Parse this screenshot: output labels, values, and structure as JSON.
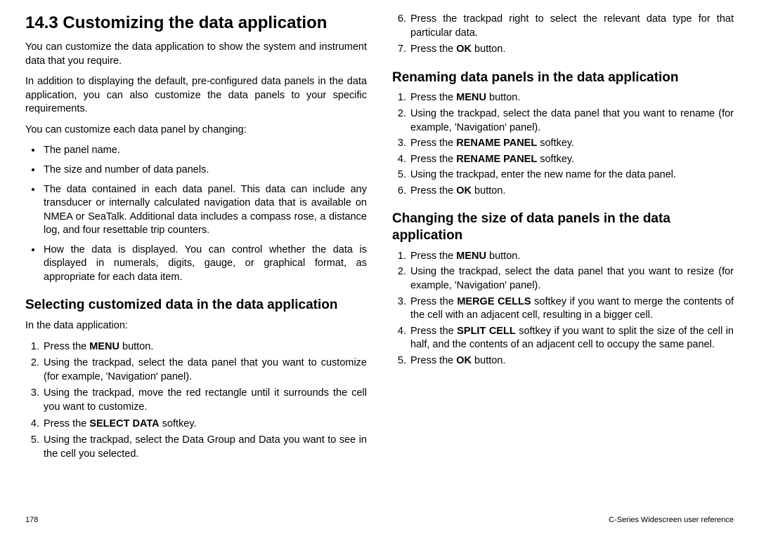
{
  "heading": "14.3 Customizing the data application",
  "para1": "You can customize the data application to show the system and instrument data that you require.",
  "para2": "In addition to displaying the default, pre-configured data panels in the data application, you can also customize the data panels to your specific requirements.",
  "para3": "You can customize each data panel by changing:",
  "bullets": {
    "b1": "The panel name.",
    "b2": "The size and number of data panels.",
    "b3": "The data contained in each data panel. This data can include any transducer or internally calculated navigation data that is available on NMEA or SeaTalk. Additional data includes a compass rose, a distance log, and four resettable trip counters.",
    "b4": "How the data is displayed. You can control whether the data is displayed in numerals, digits, gauge, or graphical format, as appropriate for each data item."
  },
  "sec1": {
    "title": "Selecting customized data in the data application",
    "intro": "In the data application:",
    "s1a": "Press the ",
    "s1b": "MENU",
    "s1c": " button.",
    "s2": "Using the trackpad, select the data panel that you want to customize (for example, 'Navigation' panel).",
    "s3": "Using the trackpad, move the red rectangle until it surrounds the cell you want to customize.",
    "s4a": "Press the ",
    "s4b": "SELECT DATA",
    "s4c": " softkey.",
    "s5": "Using the trackpad, select the Data Group and Data you want to see in the cell you selected.",
    "s6": "Press the trackpad right to select the relevant data type for that particular data.",
    "s7a": "Press the ",
    "s7b": "OK",
    "s7c": " button."
  },
  "sec2": {
    "title": "Renaming data panels in the data application",
    "s1a": "Press the ",
    "s1b": "MENU",
    "s1c": " button.",
    "s2": "Using the trackpad, select the data panel that you want to rename (for example, 'Navigation' panel).",
    "s3a": "Press the ",
    "s3b": "RENAME PANEL",
    "s3c": " softkey.",
    "s4a": "Press the ",
    "s4b": "RENAME PANEL",
    "s4c": " softkey.",
    "s5": "Using the trackpad, enter the new name for the data panel.",
    "s6a": "Press the ",
    "s6b": "OK",
    "s6c": " button."
  },
  "sec3": {
    "title": "Changing the size of data panels in the data application",
    "s1a": "Press the ",
    "s1b": "MENU",
    "s1c": " button.",
    "s2": "Using the trackpad, select the data panel that you want to resize (for example, 'Navigation' panel).",
    "s3a": "Press the ",
    "s3b": "MERGE CELLS",
    "s3c": " softkey if you want to merge the contents of the cell with an adjacent cell, resulting in a bigger cell.",
    "s4a": "Press the ",
    "s4b": "SPLIT CELL",
    "s4c": " softkey if you want to split the size of the cell in half, and the contents of an adjacent cell to occupy the same panel.",
    "s5a": "Press the ",
    "s5b": "OK",
    "s5c": " button."
  },
  "footer": {
    "page": "178",
    "ref": "C-Series Widescreen user reference"
  }
}
